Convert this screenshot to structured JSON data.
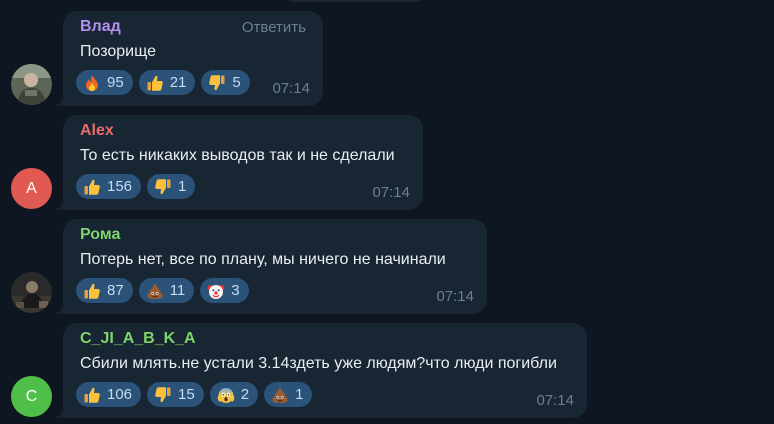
{
  "colors": {
    "background": "#0e1621",
    "bubble": "#182533",
    "reaction_pill": "#2b5278",
    "text": "#e9eef2",
    "meta": "#6d7f8f"
  },
  "messages": [
    {
      "author": "Влад",
      "author_color": "#b48ef0",
      "avatar": "photo",
      "reply_label": "Ответить",
      "text": "Позорище",
      "time": "07:14",
      "reactions": [
        {
          "emoji": "fire-icon",
          "count": "95"
        },
        {
          "emoji": "thumbs-up-icon",
          "count": "21"
        },
        {
          "emoji": "thumbs-down-icon",
          "count": "5"
        }
      ]
    },
    {
      "author": "Alex",
      "author_color": "#e86c6c",
      "avatar": "letter",
      "avatar_letter": "A",
      "avatar_color": "#e05a52",
      "text": "То есть никаких выводов так и не сделали",
      "time": "07:14",
      "reactions": [
        {
          "emoji": "thumbs-up-icon",
          "count": "156"
        },
        {
          "emoji": "thumbs-down-icon",
          "count": "1"
        }
      ]
    },
    {
      "author": "Рома",
      "author_color": "#7fd46a",
      "avatar": "photo",
      "text": "Потерь нет, все по плану, мы ничего не начинали",
      "time": "07:14",
      "reactions": [
        {
          "emoji": "thumbs-up-icon",
          "count": "87"
        },
        {
          "emoji": "poop-icon",
          "count": "11"
        },
        {
          "emoji": "clown-icon",
          "count": "3"
        }
      ]
    },
    {
      "author": "C_JI_A_B_K_A",
      "author_color": "#7fd46a",
      "avatar": "letter",
      "avatar_letter": "C",
      "avatar_color": "#4fbf4a",
      "text": "Сбили млять.не устали 3.14здеть уже людям?что люди погибли",
      "time": "07:14",
      "reactions": [
        {
          "emoji": "thumbs-up-icon",
          "count": "106"
        },
        {
          "emoji": "thumbs-down-icon",
          "count": "15"
        },
        {
          "emoji": "scream-icon",
          "count": "2"
        },
        {
          "emoji": "poop-icon",
          "count": "1"
        }
      ]
    }
  ]
}
